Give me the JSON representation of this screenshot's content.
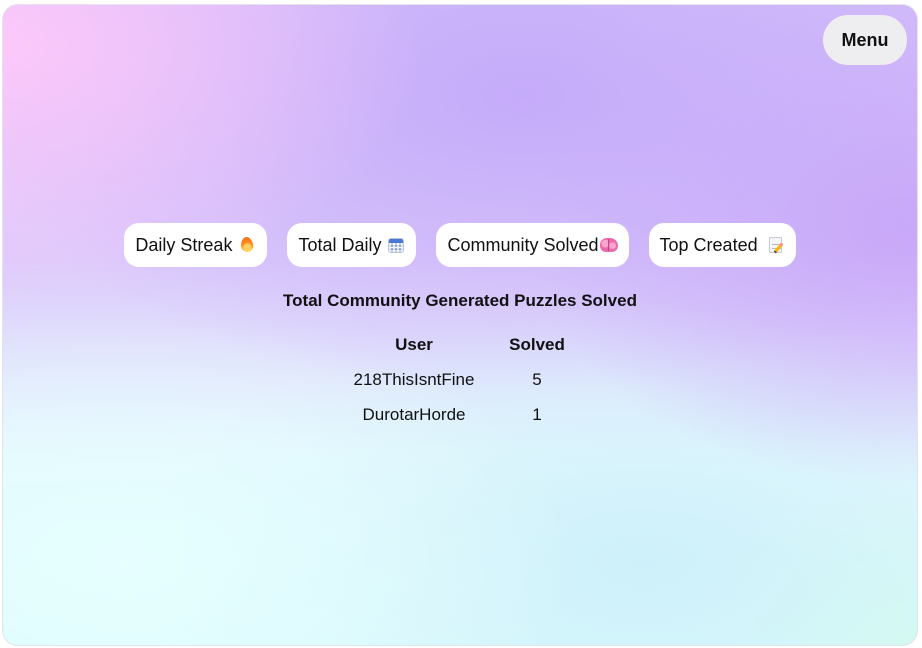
{
  "header": {
    "menu_label": "Menu"
  },
  "tabs": [
    {
      "label": "Daily Streak",
      "icon": "fire-icon"
    },
    {
      "label": "Total Daily",
      "icon": "calendar-icon"
    },
    {
      "label": "Community Solved",
      "icon": "brain-icon"
    },
    {
      "label": "Top Created",
      "icon": "memo-icon"
    }
  ],
  "leaderboard": {
    "title": "Total Community Generated Puzzles Solved",
    "columns": [
      "User",
      "Solved"
    ],
    "rows": [
      {
        "user": "218ThisIsntFine",
        "solved": "5"
      },
      {
        "user": "DurotarHorde",
        "solved": "1"
      }
    ]
  },
  "colors": {
    "tab_background": "#ffffff",
    "menu_background": "#eeeef0",
    "text": "#111111"
  }
}
